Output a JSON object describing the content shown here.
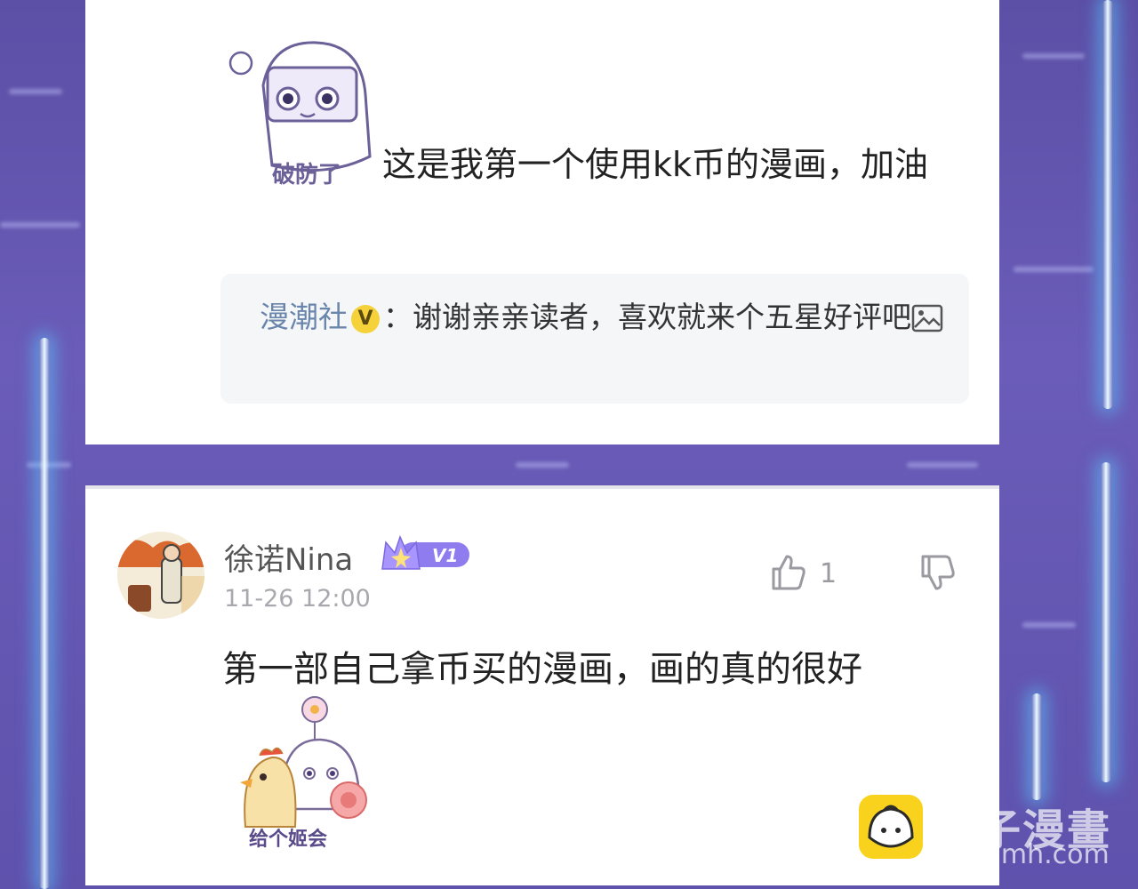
{
  "comment1": {
    "sticker_caption": "破防了",
    "text": "这是我第一个使用kk币的漫画，加油",
    "reply": {
      "author": "漫潮社",
      "badge": "V",
      "separator": "：",
      "text": "谢谢亲亲读者，喜欢就来个五星好评吧"
    }
  },
  "comment2": {
    "username": "徐诺Nina",
    "level": "V1",
    "timestamp": "11-26 12:00",
    "like_count": "1",
    "text": "第一部自己拿币买的漫画，画的真的很好",
    "sticker_caption": "给个姬会"
  },
  "watermark": {
    "title": "包子漫畫",
    "url": "baozimh.com"
  },
  "colors": {
    "background": "#5e52ad",
    "reply_author": "#6a86ad",
    "badge": "#f6d23a",
    "level_badge": "#8f7df0"
  }
}
